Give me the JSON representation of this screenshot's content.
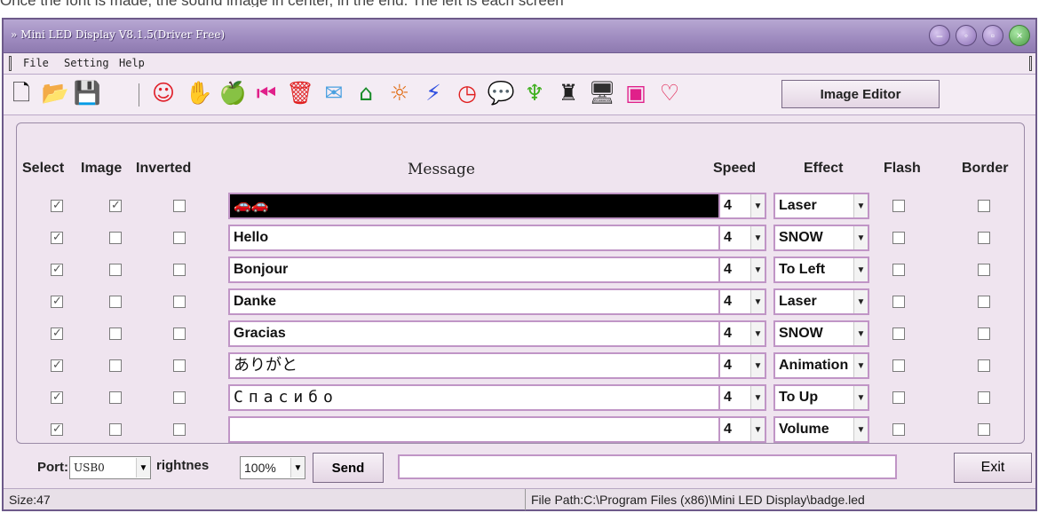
{
  "page_caption": "Once the font is made, the sound image in center, in the end. The left is each screen",
  "window": {
    "title": "Mini LED Display V8.1.5(Driver Free)",
    "controls": [
      "minimize",
      "restore",
      "maximize",
      "close"
    ]
  },
  "menu": [
    "File",
    "Setting",
    "Help"
  ],
  "toolbar": {
    "icons": [
      {
        "name": "new-file-icon",
        "glyph": "🗋",
        "color": "#111111"
      },
      {
        "name": "open-folder-icon",
        "glyph": "📂",
        "color": "#111111"
      },
      {
        "name": "save-icon",
        "glyph": "💾",
        "color": "#111111"
      },
      {
        "name": "smiley-icon",
        "glyph": "☺",
        "color": "#e0202a"
      },
      {
        "name": "thumb-icon",
        "glyph": "✋",
        "color": "#c8a020"
      },
      {
        "name": "apple-icon",
        "glyph": "🍏",
        "color": "#3cc83c"
      },
      {
        "name": "rewind-icon",
        "glyph": "⏮",
        "color": "#e0208a"
      },
      {
        "name": "trash-icon",
        "glyph": "🗑",
        "color": "#e02020"
      },
      {
        "name": "mail-icon",
        "glyph": "✉",
        "color": "#4aa0e0"
      },
      {
        "name": "home-icon",
        "glyph": "⌂",
        "color": "#1a8c2a"
      },
      {
        "name": "sun-icon",
        "glyph": "☼",
        "color": "#e06a10"
      },
      {
        "name": "lightning-icon",
        "glyph": "⚡",
        "color": "#3050e0"
      },
      {
        "name": "clock-icon",
        "glyph": "◷",
        "color": "#e02020"
      },
      {
        "name": "chat-icon",
        "glyph": "💬",
        "color": "#e02040"
      },
      {
        "name": "plant-icon",
        "glyph": "♆",
        "color": "#40b020"
      },
      {
        "name": "castle-icon",
        "glyph": "♜",
        "color": "#202020"
      },
      {
        "name": "computer-icon",
        "glyph": "🖥",
        "color": "#303030"
      },
      {
        "name": "music-player-icon",
        "glyph": "▣",
        "color": "#e0208a"
      },
      {
        "name": "heart-icon",
        "glyph": "♡",
        "color": "#e02050"
      }
    ],
    "image_editor_label": "Image Editor"
  },
  "table": {
    "headers": {
      "select": "Select",
      "image": "Image",
      "inverted": "Inverted",
      "message": "Message",
      "speed": "Speed",
      "effect": "Effect",
      "flash": "Flash",
      "border": "Border"
    },
    "rows": [
      {
        "select": true,
        "image": true,
        "inverted": false,
        "message": "🚗🚗 ",
        "speed": "4",
        "effect": "Laser",
        "flash": false,
        "border": false,
        "style": "dark"
      },
      {
        "select": true,
        "image": false,
        "inverted": false,
        "message": "Hello",
        "speed": "4",
        "effect": "SNOW",
        "flash": false,
        "border": false,
        "style": ""
      },
      {
        "select": true,
        "image": false,
        "inverted": false,
        "message": "Bonjour",
        "speed": "4",
        "effect": "To Left",
        "flash": false,
        "border": false,
        "style": ""
      },
      {
        "select": true,
        "image": false,
        "inverted": false,
        "message": "Danke",
        "speed": "4",
        "effect": "Laser",
        "flash": false,
        "border": false,
        "style": ""
      },
      {
        "select": true,
        "image": false,
        "inverted": false,
        "message": "Gracias",
        "speed": "4",
        "effect": "SNOW",
        "flash": false,
        "border": false,
        "style": ""
      },
      {
        "select": true,
        "image": false,
        "inverted": false,
        "message": "ありがと",
        "speed": "4",
        "effect": "Animation",
        "flash": false,
        "border": false,
        "style": "jp"
      },
      {
        "select": true,
        "image": false,
        "inverted": false,
        "message": "Спасибо",
        "speed": "4",
        "effect": "To Up",
        "flash": false,
        "border": false,
        "style": "mono"
      },
      {
        "select": true,
        "image": false,
        "inverted": false,
        "message": "",
        "speed": "4",
        "effect": "Volume",
        "flash": false,
        "border": false,
        "style": ""
      }
    ]
  },
  "bottom": {
    "port_label": "Port:",
    "port_value": "USB0",
    "brightness_label": "rightnes",
    "brightness_value": "100%",
    "send_label": "Send",
    "exit_label": "Exit"
  },
  "status": {
    "size": "Size:47",
    "file_path": "File Path:C:\\Program Files (x86)\\Mini LED Display\\badge.led"
  }
}
